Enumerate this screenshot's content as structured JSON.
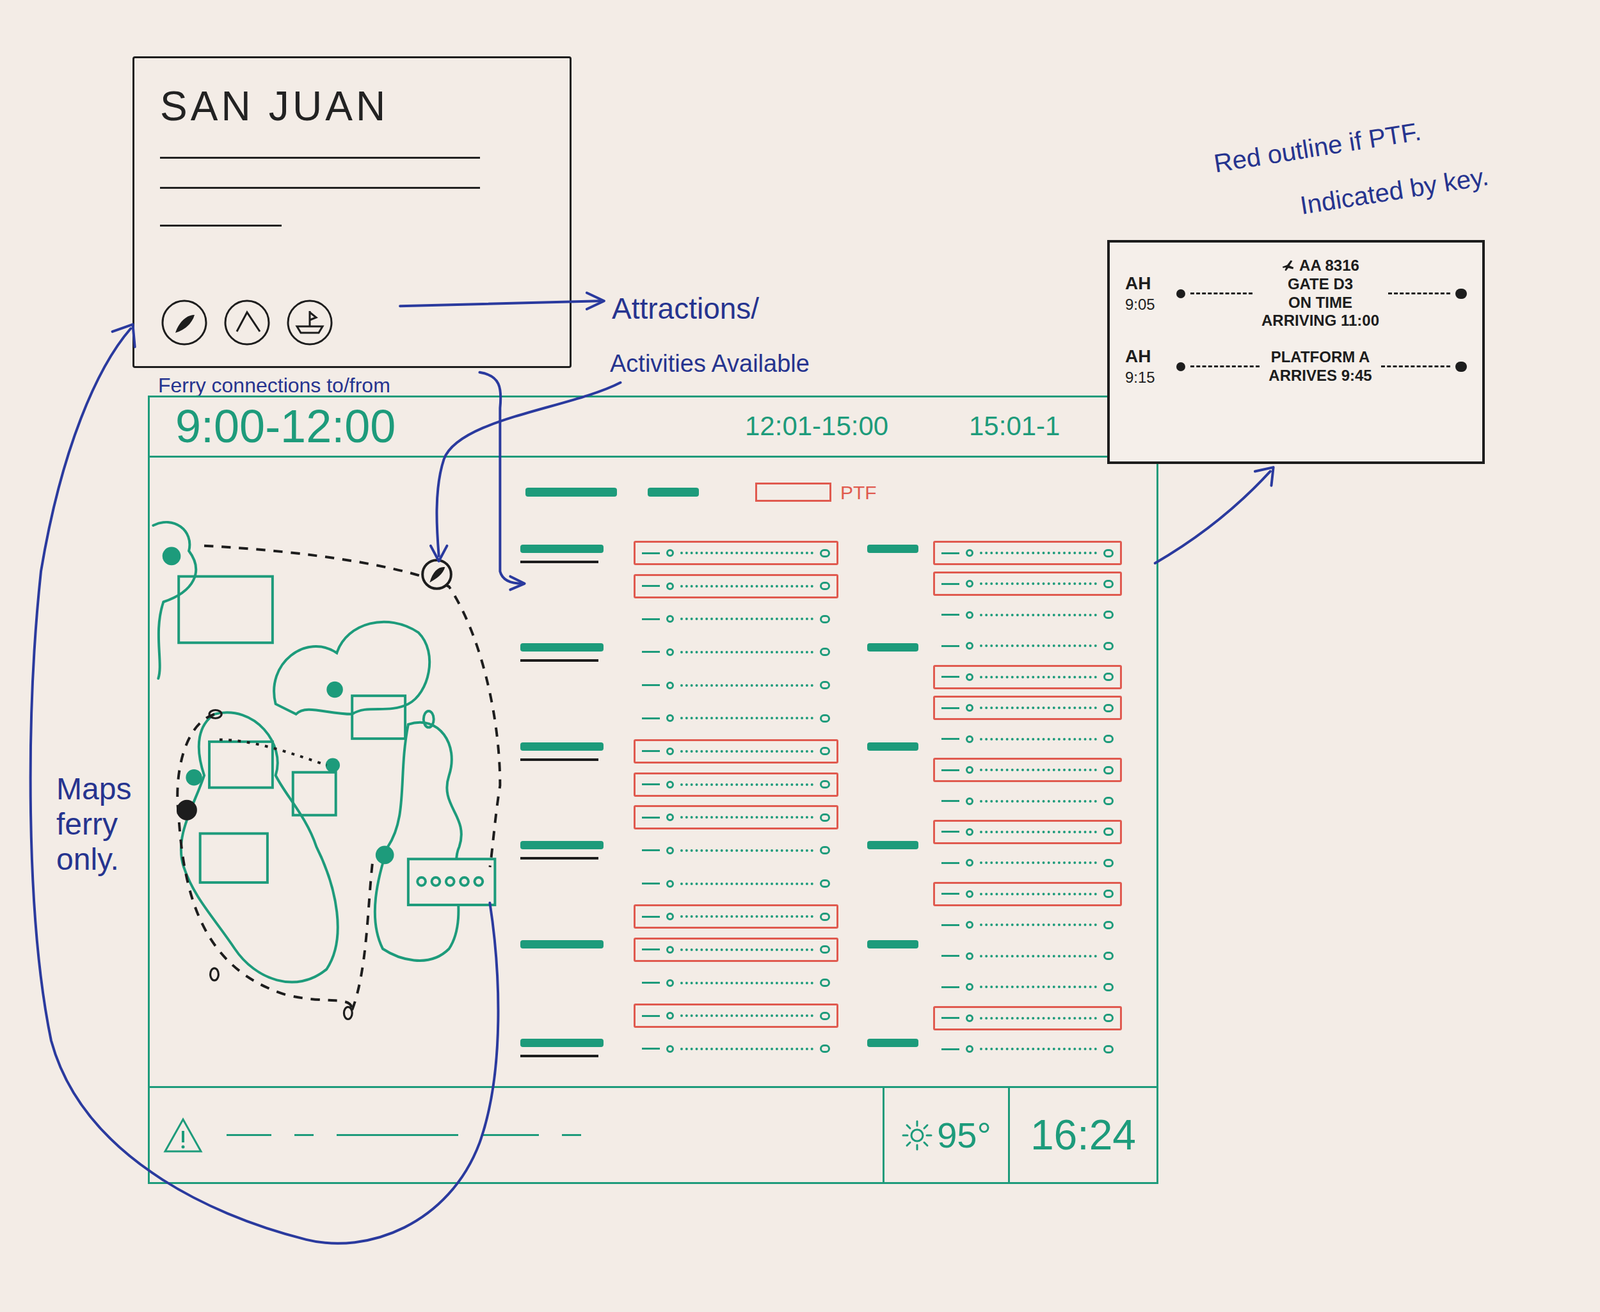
{
  "destination_card": {
    "title": "SAN JUAN"
  },
  "annotations": {
    "attractions_line1": "Attractions/",
    "attractions_line2": "Activities Available",
    "ferry_connections": "Ferry connections to/from",
    "maps_note": "Maps ferry only.",
    "ptf_note_line1": "Red outline if PTF.",
    "ptf_note_line2": "Indicated by key."
  },
  "board": {
    "time_slots": [
      {
        "label": "9:00-12:00",
        "selected": true
      },
      {
        "label": "12:01-15:00",
        "selected": false
      },
      {
        "label": "15:01-1",
        "selected": false
      }
    ],
    "key": {
      "label": "PTF"
    },
    "columns": [
      {
        "markers": [
          {
            "underlined": true
          },
          {
            "underlined": true
          },
          {
            "underlined": true
          },
          {
            "underlined": true
          },
          {
            "underlined": false
          },
          {
            "underlined": true
          }
        ],
        "rows": [
          {
            "ptf": true
          },
          {
            "ptf": true
          },
          {
            "ptf": false
          },
          {
            "ptf": false
          },
          {
            "ptf": false
          },
          {
            "ptf": false
          },
          {
            "ptf": true
          },
          {
            "ptf": true
          },
          {
            "ptf": true
          },
          {
            "ptf": false
          },
          {
            "ptf": false
          },
          {
            "ptf": true
          },
          {
            "ptf": true
          },
          {
            "ptf": false
          },
          {
            "ptf": true
          },
          {
            "ptf": false
          }
        ]
      },
      {
        "markers": [
          {
            "underlined": false
          },
          {
            "underlined": false
          },
          {
            "underlined": false
          },
          {
            "underlined": false
          },
          {
            "underlined": false
          },
          {
            "underlined": false
          }
        ],
        "rows": [
          {
            "ptf": true
          },
          {
            "ptf": true
          },
          {
            "ptf": false
          },
          {
            "ptf": false
          },
          {
            "ptf": true
          },
          {
            "ptf": true
          },
          {
            "ptf": false
          },
          {
            "ptf": true
          },
          {
            "ptf": false
          },
          {
            "ptf": true
          },
          {
            "ptf": false
          },
          {
            "ptf": true
          },
          {
            "ptf": false
          },
          {
            "ptf": false
          },
          {
            "ptf": false
          },
          {
            "ptf": true
          },
          {
            "ptf": false
          }
        ]
      }
    ],
    "footer": {
      "weather": "95°",
      "clock": "16:24"
    }
  },
  "detail_card": {
    "entries": [
      {
        "kind": "flight",
        "carrier": "AH",
        "time": "9:05",
        "lines": [
          "AA 8316",
          "GATE D3",
          "ON TIME",
          "ARRIVING 11:00"
        ]
      },
      {
        "kind": "train",
        "carrier": "AH",
        "time": "9:15",
        "lines": [
          "PLATFORM A",
          "ARRIVES 9:45"
        ]
      }
    ]
  }
}
